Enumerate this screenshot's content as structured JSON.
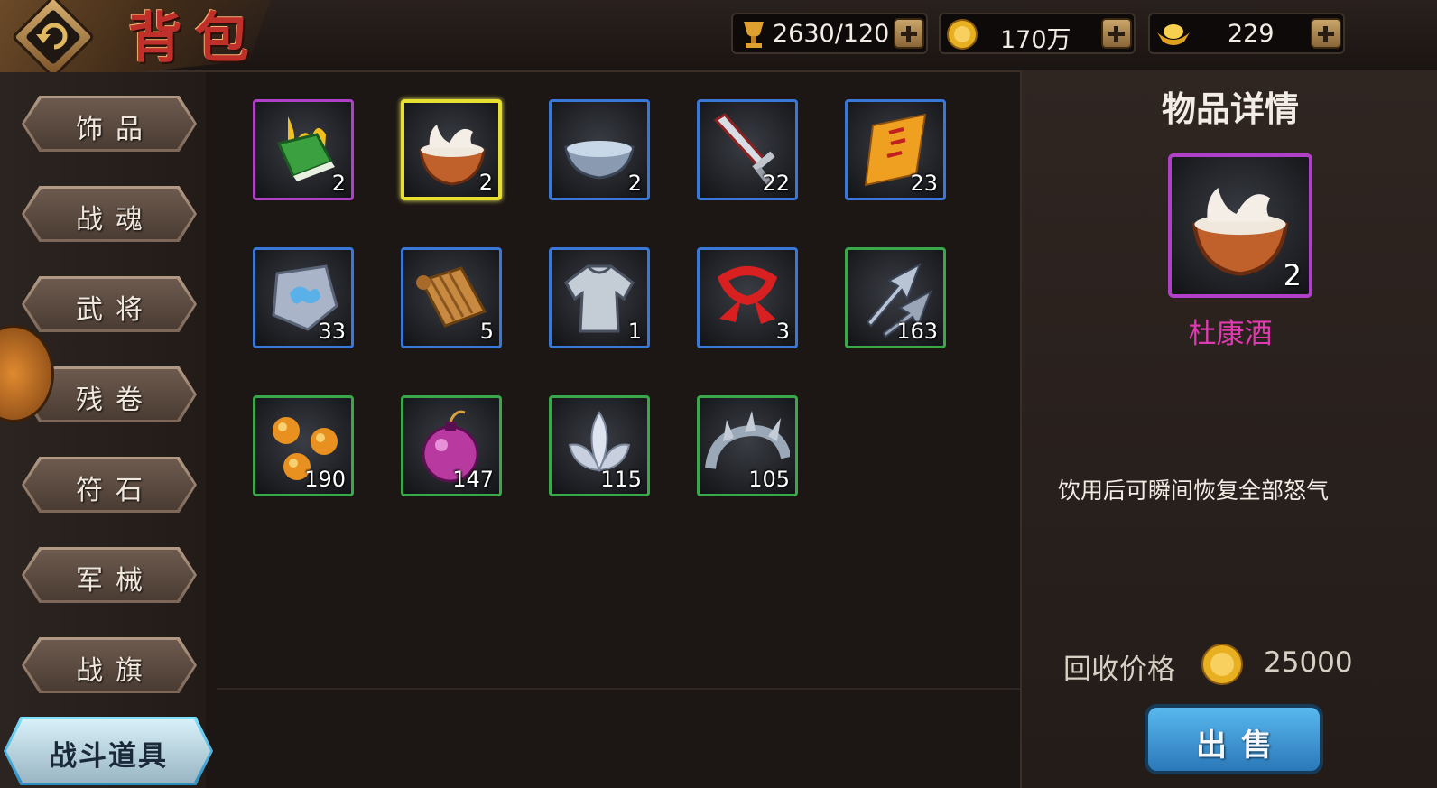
{
  "header": {
    "title": "背包",
    "resources": [
      {
        "icon": "trophy-icon",
        "value": "2630/120"
      },
      {
        "icon": "gold-coin-icon",
        "value": "170万"
      },
      {
        "icon": "gold-ingot-icon",
        "value": "229"
      }
    ]
  },
  "sidebar": {
    "tabs": [
      "饰品",
      "战魂",
      "武将",
      "残卷",
      "符石",
      "军械",
      "战旗"
    ],
    "active_tab": "战斗道具"
  },
  "inventory": {
    "items": [
      {
        "icon": "flaming-book-icon",
        "rarity": "purple",
        "qty": "2"
      },
      {
        "icon": "wine-bowl-icon",
        "rarity": "purple",
        "qty": "2",
        "selected": true
      },
      {
        "icon": "water-bowl-icon",
        "rarity": "blue",
        "qty": "2"
      },
      {
        "icon": "sword-icon",
        "rarity": "blue",
        "qty": "22"
      },
      {
        "icon": "talisman-icon",
        "rarity": "blue",
        "qty": "23"
      },
      {
        "icon": "cloud-stone-icon",
        "rarity": "blue",
        "qty": "33"
      },
      {
        "icon": "scroll-icon",
        "rarity": "blue",
        "qty": "5"
      },
      {
        "icon": "robe-icon",
        "rarity": "blue",
        "qty": "1"
      },
      {
        "icon": "red-scarf-icon",
        "rarity": "blue",
        "qty": "3"
      },
      {
        "icon": "arrowheads-icon",
        "rarity": "green",
        "qty": "163"
      },
      {
        "icon": "golden-orbs-icon",
        "rarity": "green",
        "qty": "190"
      },
      {
        "icon": "bomb-icon",
        "rarity": "green",
        "qty": "147"
      },
      {
        "icon": "lotus-icon",
        "rarity": "green",
        "qty": "115"
      },
      {
        "icon": "spiked-ring-icon",
        "rarity": "green",
        "qty": "105"
      }
    ]
  },
  "detail": {
    "title": "物品详情",
    "name": "杜康酒",
    "qty": "2",
    "description": "饮用后可瞬间恢复全部怒气",
    "price_label": "回收价格",
    "price_value": "25000",
    "sell_label": "出售"
  },
  "colors": {
    "purple": "#b040c8",
    "blue": "#3a78d8",
    "green": "#3aa84a",
    "selected": "#e8e030",
    "item_name": "#e03ab0",
    "sell_button": "#3a90d0"
  }
}
